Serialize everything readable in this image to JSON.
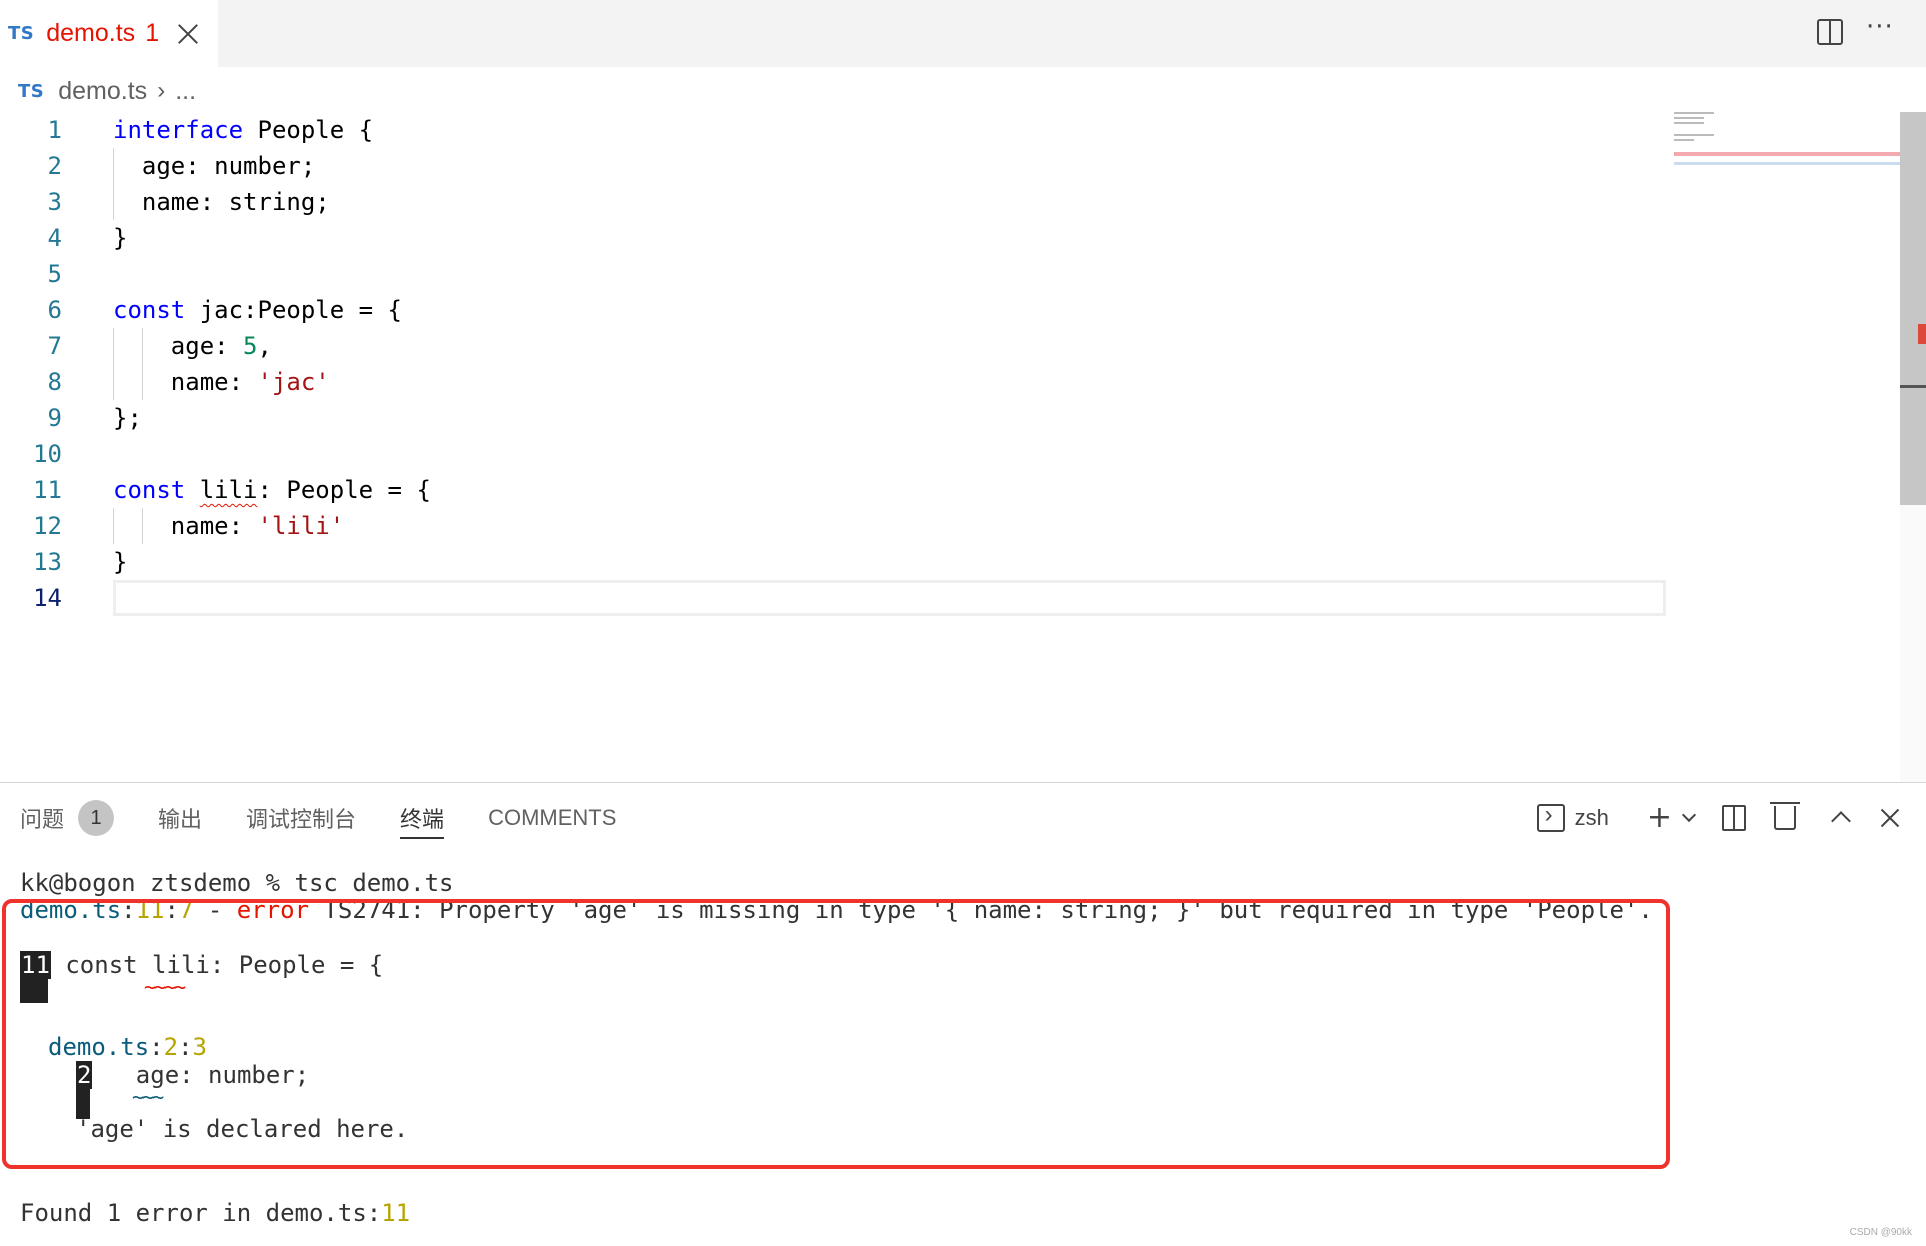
{
  "tab": {
    "lang_badge": "TS",
    "file_name": "demo.ts",
    "problem_count": "1"
  },
  "breadcrumb": {
    "lang_badge": "TS",
    "file": "demo.ts",
    "more": "..."
  },
  "editor": {
    "line_numbers": [
      "1",
      "2",
      "3",
      "4",
      "5",
      "6",
      "7",
      "8",
      "9",
      "10",
      "11",
      "12",
      "13",
      "14"
    ],
    "code": {
      "l1_kw": "interface",
      "l1_rest": " People {",
      "l2": "  age: number;",
      "l3": "  name: string;",
      "l4": "}",
      "l6_kw": "const",
      "l6_rest": " jac:People = {",
      "l7_key": "    age: ",
      "l7_num": "5",
      "l7_end": ",",
      "l8_key": "    name: ",
      "l8_str": "'jac'",
      "l9": "};",
      "l11_kw": "const",
      "l11_sp": " ",
      "l11_var": "lili",
      "l11_rest": ": People = {",
      "l12_key": "    name: ",
      "l12_str": "'lili'",
      "l13": "}"
    }
  },
  "panel": {
    "tabs": {
      "problems": "问题",
      "problems_count": "1",
      "output": "输出",
      "debug_console": "调试控制台",
      "terminal": "终端",
      "comments": "COMMENTS"
    },
    "shell_name": "zsh",
    "add_label": "+"
  },
  "terminal": {
    "prompt": "kk@bogon ztsdemo % tsc demo.ts",
    "err_file": "demo.ts",
    "err_sep1": ":",
    "err_line": "11",
    "err_sep2": ":",
    "err_col": "7",
    "err_dash": " - ",
    "err_word": "error",
    "err_msg": " TS2741: Property 'age' is missing in type '{ name: string; }' but required in type 'People'.",
    "src_line_no": "11",
    "src_line": " const lili: People = {",
    "squiggle1": "~~~~",
    "rel_file": "demo.ts",
    "rel_sep1": ":",
    "rel_line": "2",
    "rel_sep2": ":",
    "rel_col": "3",
    "rel_line_no": "2",
    "rel_src": "   age: number;",
    "squiggle2": "~~~",
    "declared": "'age' is declared here.",
    "found_prefix": "Found 1 error in demo.ts:",
    "found_line": "11"
  },
  "watermark": "CSDN @90kk"
}
